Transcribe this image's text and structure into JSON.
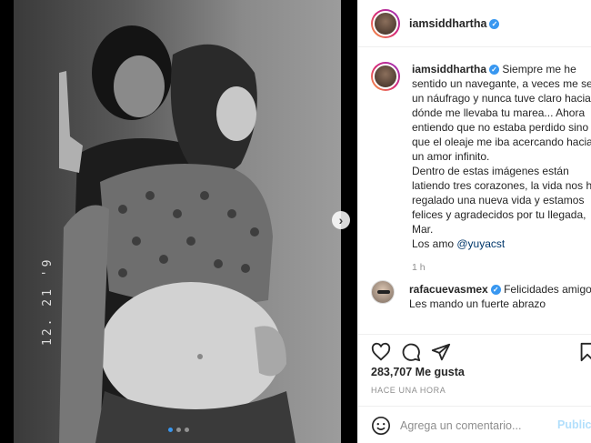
{
  "post": {
    "username": "iamsiddhartha",
    "date_stamp": "12. 21 '9",
    "caption": {
      "username": "iamsiddhartha",
      "text": "Siempre me he sentido un navegante, a veces me sen un náufrago y nunca tuve claro hacia a dónde me llevaba tu marea... Ahora entiendo que no estaba perdido sino que el oleaje me iba acercando hacia un amor infinito.\nDentro de estas imágenes están latiendo tres corazones, la vida nos ha regalado una nueva vida y estamos felices y agradecidos por tu llegada, Mar.",
      "closing": "Los amo ",
      "mention": "@yuyacst",
      "time": "1 h"
    },
    "comment": {
      "username": "rafacuevasmex",
      "text": "Felicidades amigo. Les mando un fuerte abrazo"
    },
    "likes": "283,707 Me gusta",
    "date_label": "HACE UNA HORA",
    "add_comment_placeholder": "Agrega un comentario...",
    "publish_label": "Publica"
  },
  "icons": {
    "like": "heart-icon",
    "comment": "comment-bubble-icon",
    "share": "paper-plane-icon",
    "save": "bookmark-icon",
    "emoji": "smiley-icon",
    "next": "chevron-right-icon",
    "verified": "verified-badge-icon"
  },
  "colors": {
    "accent": "#3897f0",
    "link": "#00376b",
    "muted": "#8e8e8e",
    "publish_disabled": "#b2dffc"
  }
}
